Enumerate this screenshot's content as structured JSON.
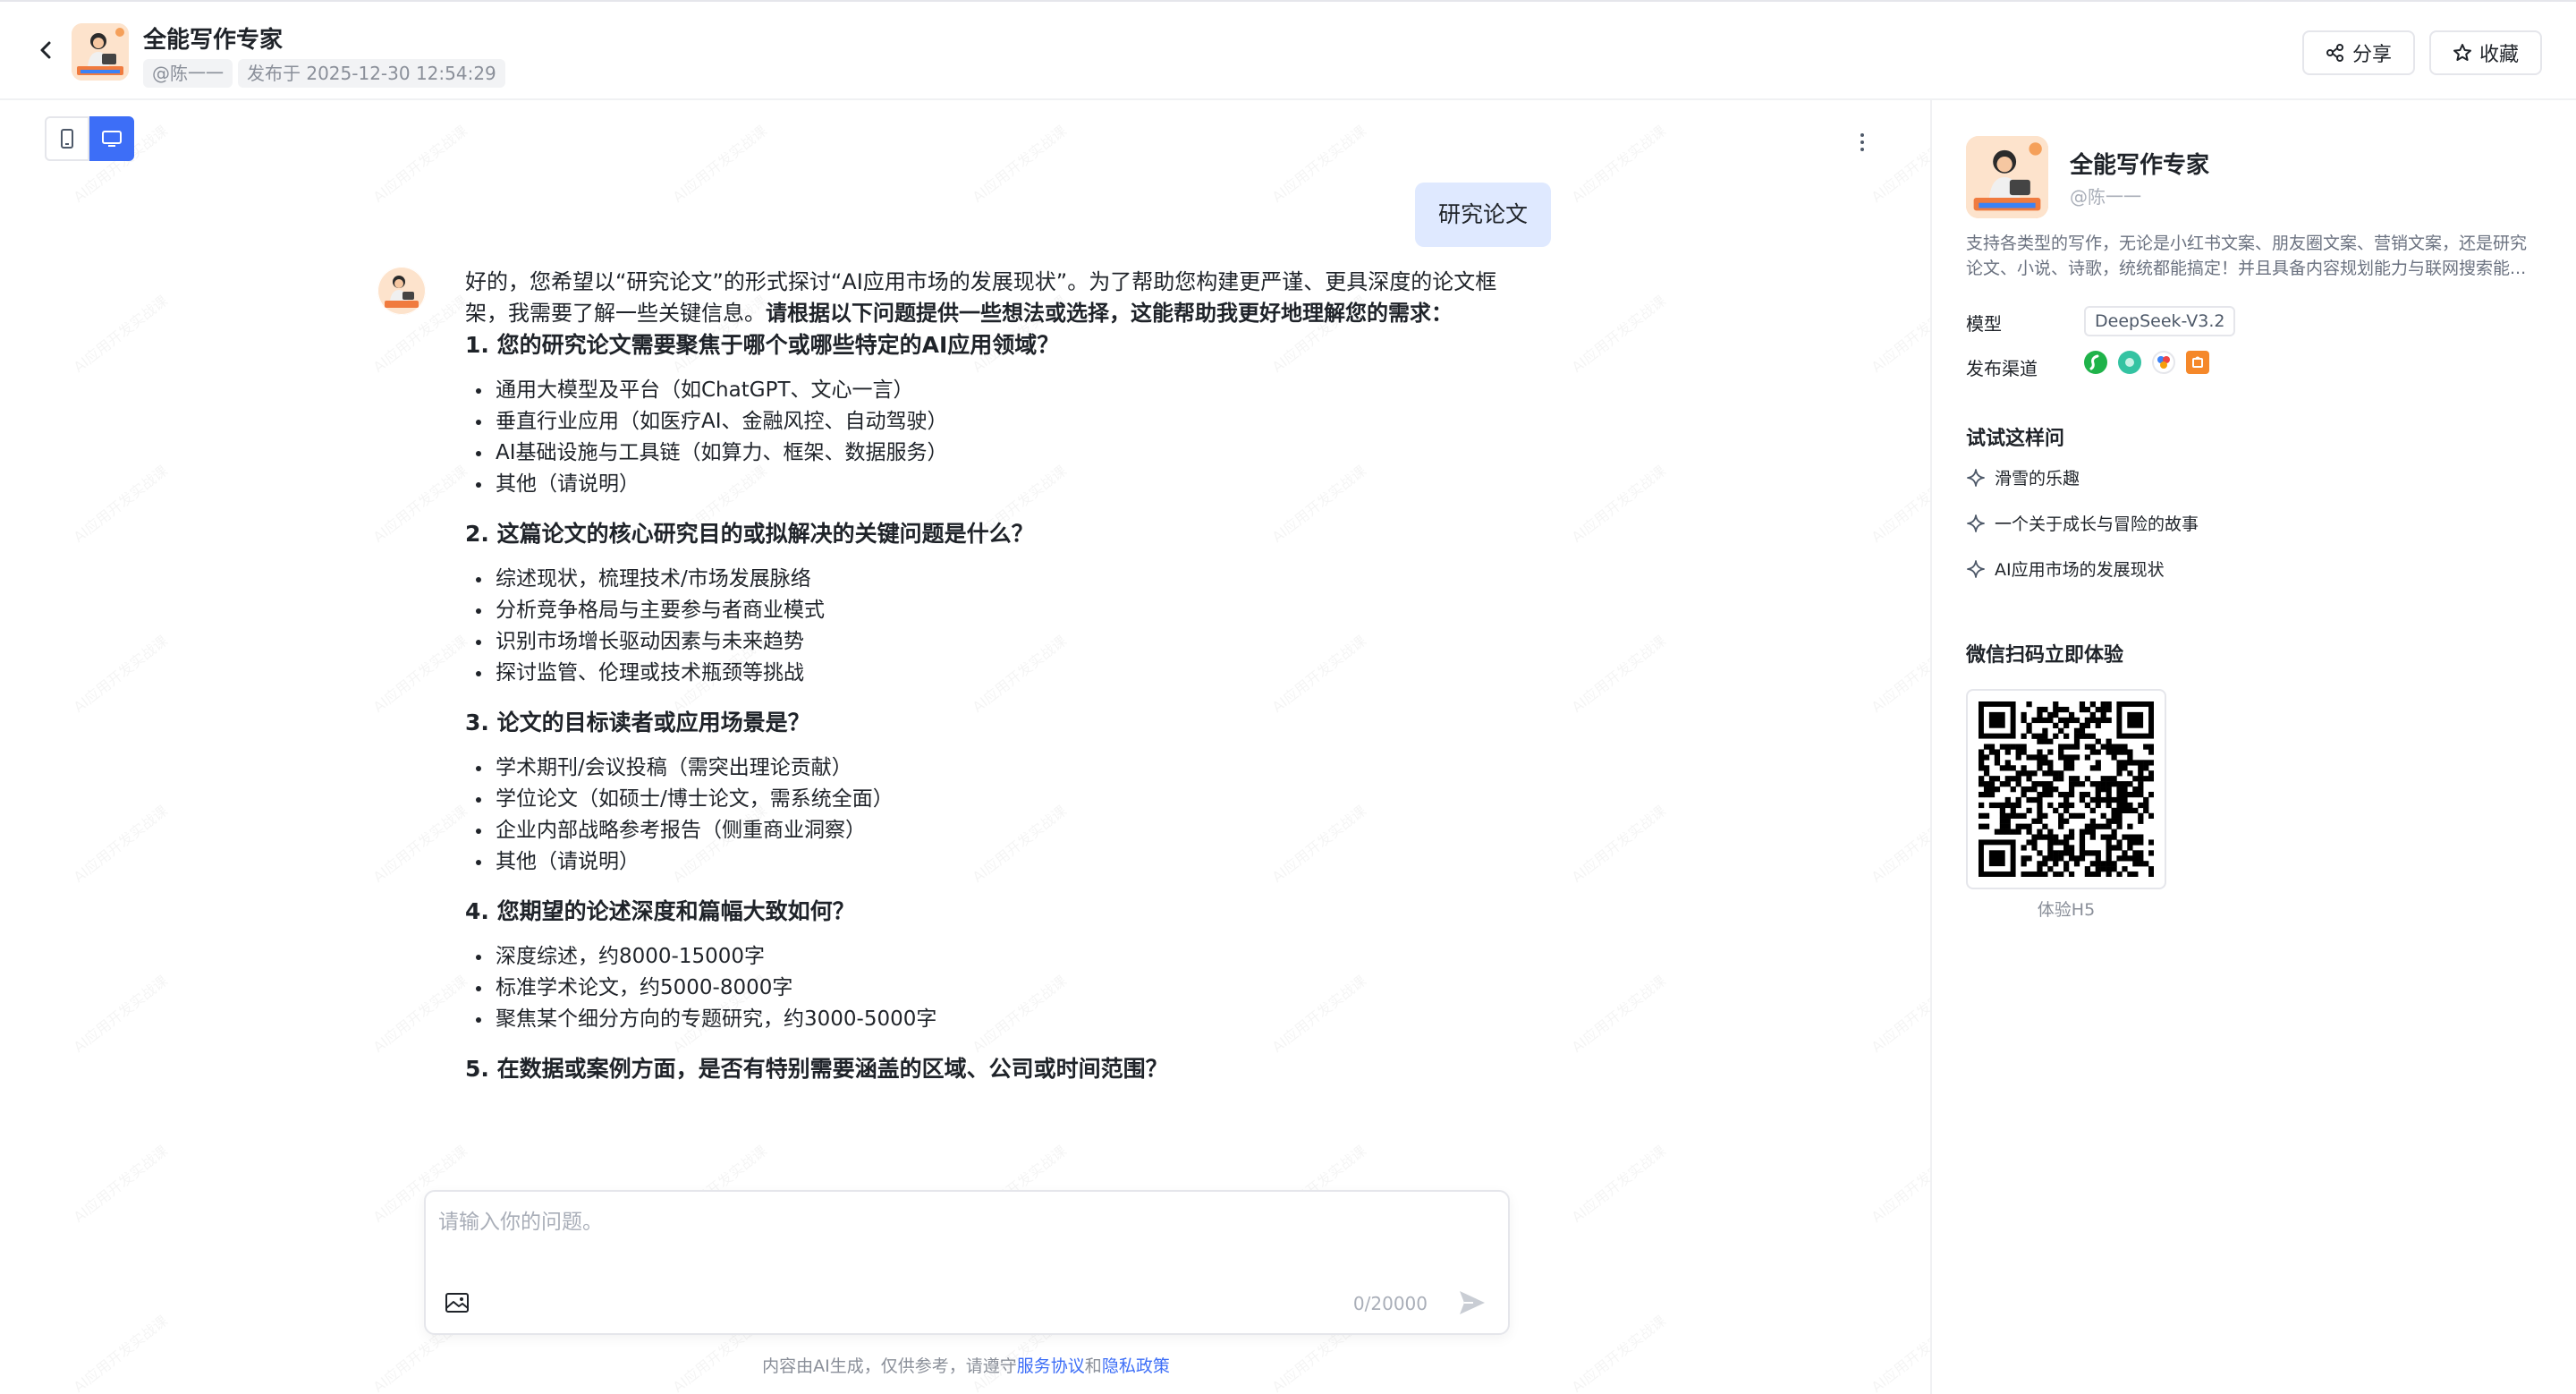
{
  "header": {
    "title": "全能写作专家",
    "author": "@陈一一",
    "published": "发布于 2025-12-30 12:54:29",
    "share_label": "分享",
    "favorite_label": "收藏"
  },
  "chat": {
    "user_message": "研究论文",
    "bot_intro_plain": "好的，您希望以“研究论文”的形式探讨“AI应用市场的发展现状”。为了帮助您构建更严谨、更具深度的论文框架，我需要了解一些关键信息。",
    "bot_intro_bold": "请根据以下问题提供一些想法或选择，这能帮助我更好地理解您的需求：",
    "questions": [
      {
        "title": "1. 您的研究论文需要聚焦于哪个或哪些特定的AI应用领域？",
        "options": [
          "通用大模型及平台（如ChatGPT、文心一言）",
          "垂直行业应用（如医疗AI、金融风控、自动驾驶）",
          "AI基础设施与工具链（如算力、框架、数据服务）",
          "其他（请说明）"
        ]
      },
      {
        "title": "2. 这篇论文的核心研究目的或拟解决的关键问题是什么？",
        "options": [
          "综述现状，梳理技术/市场发展脉络",
          "分析竞争格局与主要参与者商业模式",
          "识别市场增长驱动因素与未来趋势",
          "探讨监管、伦理或技术瓶颈等挑战"
        ]
      },
      {
        "title": "3. 论文的目标读者或应用场景是？",
        "options": [
          "学术期刊/会议投稿（需突出理论贡献）",
          "学位论文（如硕士/博士论文，需系统全面）",
          "企业内部战略参考报告（侧重商业洞察）",
          "其他（请说明）"
        ]
      },
      {
        "title": "4. 您期望的论述深度和篇幅大致如何？",
        "options": [
          "深度综述，约8000-15000字",
          "标准学术论文，约5000-8000字",
          "聚焦某个细分方向的专题研究，约3000-5000字"
        ]
      },
      {
        "title": "5. 在数据或案例方面，是否有特别需要涵盖的区域、公司或时间范围？",
        "options": []
      }
    ],
    "input_placeholder": "请输入你的问题。",
    "char_count": "0/20000",
    "disclaimer_prefix": "内容由AI生成，仅供参考，请遵守",
    "terms_link": "服务协议",
    "and_text": "和",
    "privacy_link": "隐私政策"
  },
  "panel": {
    "name": "全能写作专家",
    "handle": "@陈一一",
    "description": "支持各类型的写作，无论是小红书文案、朋友圈文案、营销文案，还是研究论文、小说、诗歌，统统都能搞定！并且具备内容规划能力与联网搜索能...",
    "model_label": "模型",
    "model_value": "DeepSeek-V3.2",
    "channels_label": "发布渠道",
    "try_title": "试试这样问",
    "try_items": [
      "滑雪的乐趣",
      "一个关于成长与冒险的故事",
      "AI应用市场的发展现状"
    ],
    "qr_title": "微信扫码立即体验",
    "qr_caption": "体验H5"
  },
  "colors": {
    "accent": "#3d6ef7",
    "user_bubble": "#dfe9ff",
    "avatar_orange": "#f5a05a"
  },
  "watermark_text": "AI应用开发实战课"
}
